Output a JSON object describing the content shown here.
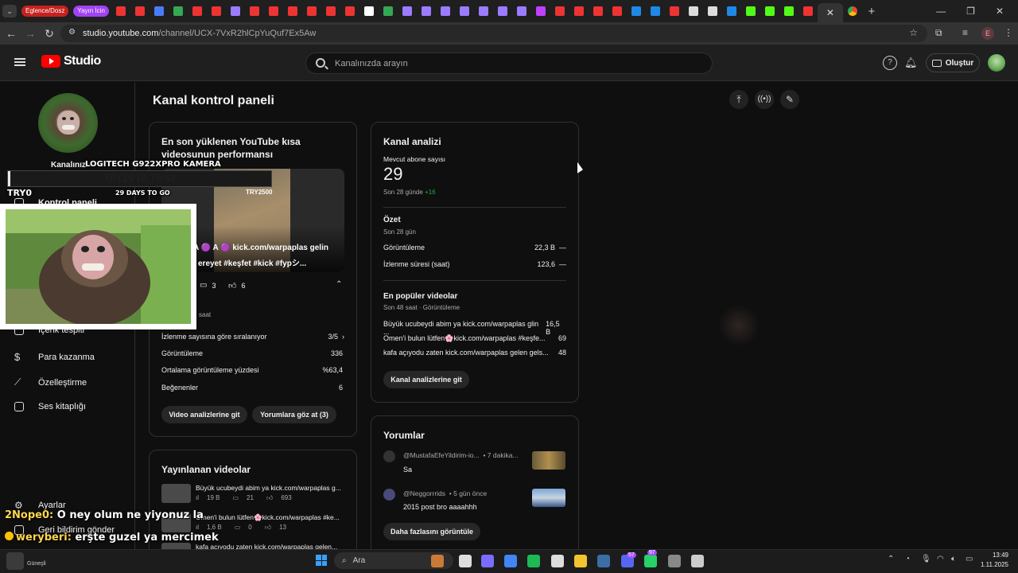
{
  "browser": {
    "tab_pill_1": "Eglence/Dosz",
    "tab_pill_2": "Yayın İcin",
    "active_tab_close": "✕",
    "new_tab": "+",
    "url_host": "studio.youtube.com",
    "url_path": "/channel/UCX-7VxR2hlCpYuQuf7Ex5Aw",
    "profile_letter": "E"
  },
  "header": {
    "logo_text": "Studio",
    "search_placeholder": "Kanalınızda arayın",
    "create_label": "Oluştur"
  },
  "sidebar": {
    "channel_label": "Kanalınız",
    "items": [
      {
        "label": "Kontrol paneli"
      },
      {
        "label": "İçerik tespiti"
      },
      {
        "label": "Para kazanma"
      },
      {
        "label": "Özelleştirme"
      },
      {
        "label": "Ses kitaplığı"
      },
      {
        "label": "Ayarlar"
      },
      {
        "label": "Geri bildirim gönder"
      }
    ]
  },
  "main": {
    "title": "Kanal kontrol paneli",
    "shorts_card": {
      "title": "En son yüklenen YouTube kısa videosunun performansı",
      "thumb_tag": "TRY2500",
      "thumb_caption_1": "A 🟣 A 🟣 kick.com/warpaplas gelin",
      "thumb_caption_2": "ereyet #keşfet #kick #fypシ...",
      "comments": "3",
      "likes": "6",
      "time_label": "saat",
      "ranking_label": "İzlenme sayısına göre sıralanıyor",
      "ranking_value": "3/5",
      "stats": [
        {
          "label": "Görüntüleme",
          "value": "336"
        },
        {
          "label": "Ortalama görüntüleme yüzdesi",
          "value": "%63,4"
        },
        {
          "label": "Beğenenler",
          "value": "6"
        }
      ],
      "btn_analytics": "Video analizlerine git",
      "btn_comments": "Yorumlara göz at (3)"
    },
    "analytics_card": {
      "title": "Kanal analizi",
      "subs_label": "Mevcut abone sayısı",
      "subs_value": "29",
      "subs_period": "Son 28 günde",
      "subs_delta": "+16",
      "summary_title": "Özet",
      "summary_period": "Son 28 gün",
      "summary": [
        {
          "label": "Görüntüleme",
          "value": "22,3 B",
          "trend": "—"
        },
        {
          "label": "İzlenme süresi (saat)",
          "value": "123,6",
          "trend": "—"
        }
      ],
      "top_title": "En popüler videolar",
      "top_period": "Son 48 saat · Görüntüleme",
      "top_videos": [
        {
          "title": "Büyük ucubeydi abim ya kick.com/warpaplas glin ...",
          "value": "16,5 B"
        },
        {
          "title": "Omen'i bulun lütfen🌸kick.com/warpaplas #keşfe...",
          "value": "69"
        },
        {
          "title": "kafa açıyodu zaten kick.com/warpaplas gelen gels...",
          "value": "48"
        }
      ],
      "btn": "Kanal analizlerine git"
    },
    "published_card": {
      "title": "Yayınlanan videolar",
      "videos": [
        {
          "title": "Büyük ucubeydi abim ya kick.com/warpaplas g...",
          "views": "19 B",
          "comments": "21",
          "likes": "693"
        },
        {
          "title": "Omen'i bulun lütfen🌸kick.com/warpaplas #ke...",
          "views": "1,6 B",
          "comments": "0",
          "likes": "13"
        },
        {
          "title": "kafa açıyodu zaten kick.com/warpaplas gelen...",
          "views": "",
          "comments": "",
          "likes": ""
        }
      ]
    },
    "comments_card": {
      "title": "Yorumlar",
      "items": [
        {
          "author": "@MustafaEfeYildirim-io...",
          "time": "• 7 dakika...",
          "text": "Sa"
        },
        {
          "author": "@Neggorrrids",
          "time": "• 5 gün önce",
          "text": "2015 post bro aaaahhh"
        }
      ],
      "btn": "Daha fazlasını görüntüle"
    }
  },
  "overlay": {
    "camera_label": "LOGITECH G922XPRO KAMERA",
    "goal_text": "TRY19 (0.76%)",
    "goal_left": "TRY0",
    "goal_days": "29 DAYS TO GO",
    "goal_progress_percent": 0.76,
    "chat": [
      {
        "user": "2Nope0:",
        "msg": "O ney olum ne yiyonuz la"
      },
      {
        "user": "weryberi:",
        "msg": "erşte guzel ya mercimek"
      },
      {
        "user": "weryberi:",
        "msg": ""
      }
    ]
  },
  "taskbar": {
    "search_label": "Ara",
    "weather": "Güneşli",
    "time": "13:49",
    "date": "1.11.2025",
    "badge_1": "57",
    "badge_2": "97"
  },
  "colors": {
    "bg": "#0f0f0f",
    "card_border": "#303030",
    "accent_red": "#ff0000",
    "positive": "#2ba640",
    "goal_bar": "#e8e8e8"
  }
}
